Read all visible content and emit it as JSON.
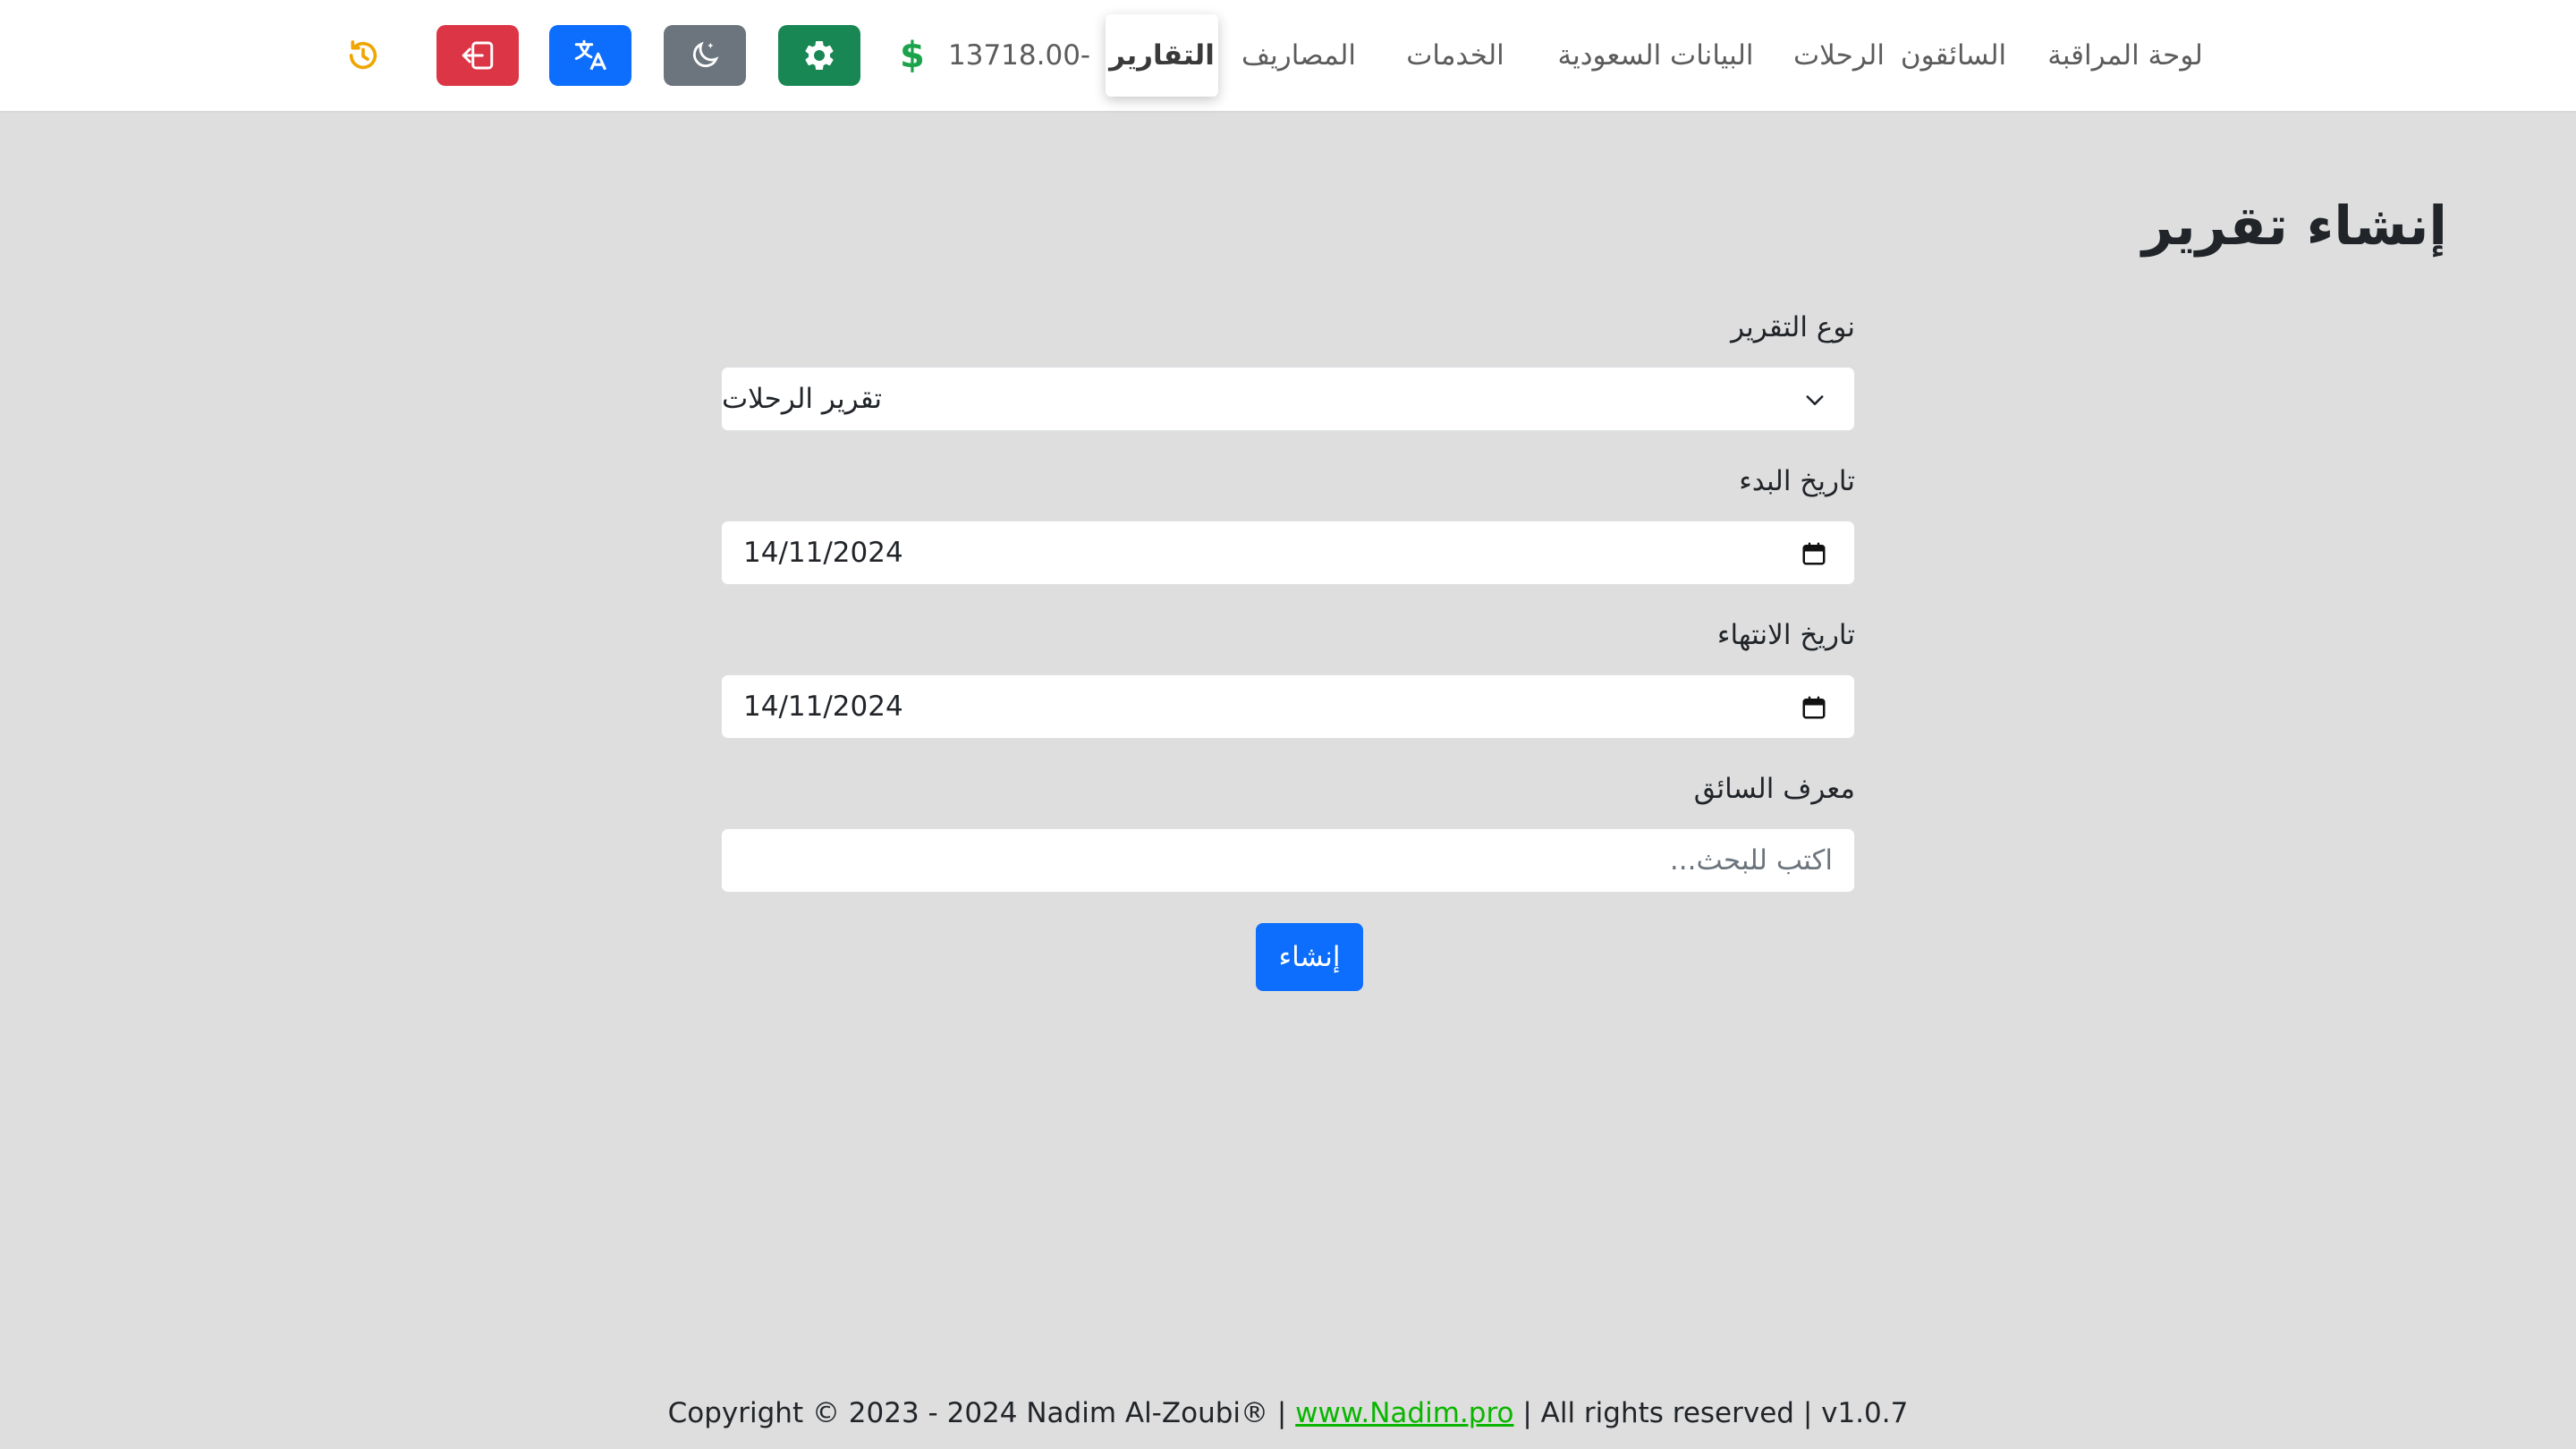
{
  "nav": {
    "links": [
      {
        "label": "لوحة المراقبة"
      },
      {
        "label": "السائقون"
      },
      {
        "label": "الرحلات"
      },
      {
        "label": "البيانات السعودية"
      },
      {
        "label": "الخدمات"
      },
      {
        "label": "المصاريف"
      },
      {
        "label": "التقارير",
        "active": true
      }
    ],
    "balance": "13718.00-",
    "balance_icon": "dollar-icon",
    "buttons": {
      "settings": {
        "icon": "gear-icon",
        "color": "#198754"
      },
      "theme": {
        "icon": "moon-icon",
        "color": "#6c757d"
      },
      "language": {
        "icon": "translate-icon",
        "color": "#0d6efd"
      },
      "logout": {
        "icon": "logout-icon",
        "color": "#dc3545"
      },
      "history": {
        "icon": "history-icon",
        "color": "#f0a500"
      }
    }
  },
  "page": {
    "title": "إنشاء تقرير"
  },
  "form": {
    "report_type_label": "نوع التقرير",
    "report_type_value": "تقرير الرحلات",
    "start_date_label": "تاريخ البدء",
    "start_date_value": "14/11/2024",
    "end_date_label": "تاريخ الانتهاء",
    "end_date_value": "14/11/2024",
    "driver_id_label": "معرف السائق",
    "driver_id_placeholder": "اكتب للبحث...",
    "submit_label": "إنشاء"
  },
  "footer": {
    "copyright": "Copyright © 2023 - 2024 Nadim Al-Zoubi® |",
    "link_text": "www.Nadim.pro",
    "suffix": "| All rights reserved | v1.0.7"
  },
  "colors": {
    "background": "#dedede",
    "primary": "#0d6efd",
    "footer_link": "#0ab500"
  }
}
